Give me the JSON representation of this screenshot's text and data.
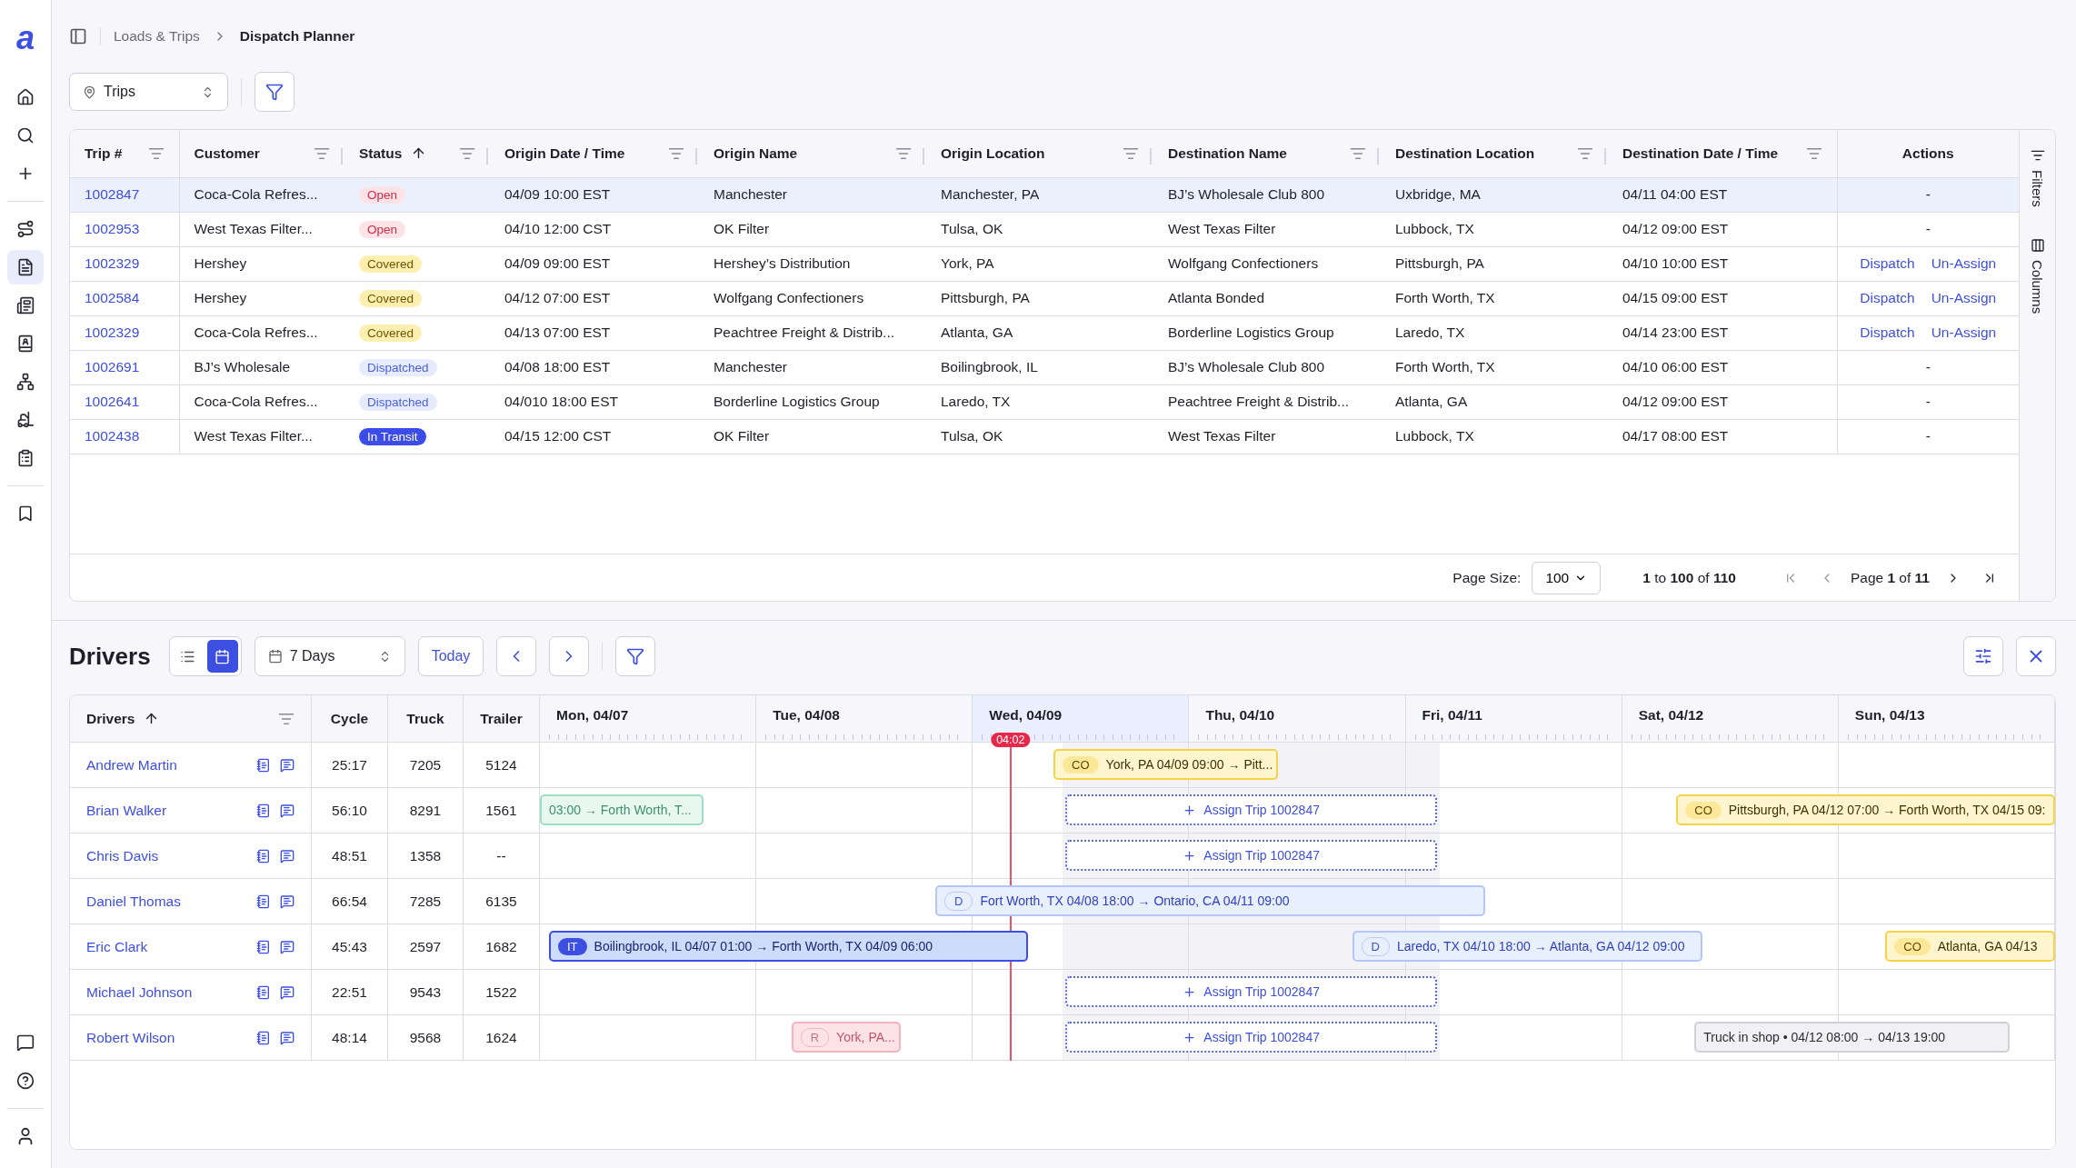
{
  "sidebar": {
    "logo": "a",
    "items": [
      {
        "selected": false
      },
      {
        "selected": false
      },
      {
        "selected": false
      },
      {
        "selected": false
      },
      {
        "selected": true
      },
      {
        "selected": false
      },
      {
        "selected": false
      },
      {
        "selected": false
      },
      {
        "selected": false
      },
      {
        "selected": false
      },
      {
        "selected": false
      }
    ]
  },
  "breadcrumb": [
    "Loads & Trips",
    "Dispatch Planner"
  ],
  "view_select": {
    "value": "Trips"
  },
  "trips_table": {
    "columns": [
      {
        "label": "Trip #",
        "sorted": false,
        "filterable": true
      },
      {
        "label": "Customer",
        "sorted": false,
        "filterable": true
      },
      {
        "label": "Status",
        "sorted": true,
        "filterable": true
      },
      {
        "label": "Origin Date / Time",
        "sorted": false,
        "filterable": true
      },
      {
        "label": "Origin Name",
        "sorted": false,
        "filterable": true
      },
      {
        "label": "Origin Location",
        "sorted": false,
        "filterable": true
      },
      {
        "label": "Destination Name",
        "sorted": false,
        "filterable": true
      },
      {
        "label": "Destination Location",
        "sorted": false,
        "filterable": true
      },
      {
        "label": "Destination Date / Time",
        "sorted": false,
        "filterable": true
      },
      {
        "label": "Actions",
        "sorted": false,
        "filterable": false
      }
    ],
    "rows": [
      {
        "selected": true,
        "cells": [
          "1002847",
          "Coca-Cola Refres...",
          {
            "label": "Open",
            "kind": "open"
          },
          "04/09 10:00 EST",
          "Manchester",
          "Manchester, PA",
          "BJ’s Wholesale Club 800",
          "Uxbridge, MA",
          "04/11 04:00 EST",
          "-"
        ]
      },
      {
        "selected": false,
        "cells": [
          "1002953",
          "West Texas Filter...",
          {
            "label": "Open",
            "kind": "open"
          },
          "04/10 12:00 CST",
          "OK Filter",
          "Tulsa, OK",
          "West Texas Filter",
          "Lubbock, TX",
          "04/12 09:00 EST",
          "-"
        ]
      },
      {
        "selected": false,
        "cells": [
          "1002329",
          "Hershey",
          {
            "label": "Covered",
            "kind": "covered"
          },
          "04/09 09:00 EST",
          "Hershey’s Distribution",
          "York, PA",
          "Wolfgang Confectioners",
          "Pittsburgh, PA",
          "04/10 10:00 EST",
          [
            "Dispatch",
            "Un-Assign"
          ]
        ]
      },
      {
        "selected": false,
        "cells": [
          "1002584",
          "Hershey",
          {
            "label": "Covered",
            "kind": "covered"
          },
          "04/12 07:00 EST",
          "Wolfgang Confectioners",
          "Pittsburgh, PA",
          "Atlanta Bonded",
          "Forth Worth, TX",
          "04/15 09:00 EST",
          [
            "Dispatch",
            "Un-Assign"
          ]
        ]
      },
      {
        "selected": false,
        "cells": [
          "1002329",
          "Coca-Cola Refres...",
          {
            "label": "Covered",
            "kind": "covered"
          },
          "04/13 07:00 EST",
          "Peachtree Freight & Distrib...",
          "Atlanta, GA",
          "Borderline Logistics Group",
          "Laredo, TX",
          "04/14 23:00 EST",
          [
            "Dispatch",
            "Un-Assign"
          ]
        ]
      },
      {
        "selected": false,
        "cells": [
          "1002691",
          "BJ’s Wholesale",
          {
            "label": "Dispatched",
            "kind": "dispatched"
          },
          "04/08 18:00 EST",
          "Manchester",
          "Boilingbrook, IL",
          "BJ’s Wholesale Club 800",
          "Forth Worth, TX",
          "04/10 06:00 EST",
          "-"
        ]
      },
      {
        "selected": false,
        "cells": [
          "1002641",
          "Coca-Cola Refres...",
          {
            "label": "Dispatched",
            "kind": "dispatched"
          },
          "04/010 18:00 EST",
          "Borderline Logistics Group",
          "Laredo, TX",
          "Peachtree Freight & Distrib...",
          "Atlanta, GA",
          "04/12 09:00 EST",
          "-"
        ]
      },
      {
        "selected": false,
        "cells": [
          "1002438",
          "West Texas Filter...",
          {
            "label": "In Transit",
            "kind": "in_transit"
          },
          "04/15 12:00 CST",
          "OK Filter",
          "Tulsa, OK",
          "West Texas Filter",
          "Lubbock, TX",
          "04/17 08:00 EST",
          "-"
        ]
      }
    ],
    "pagination": {
      "page_size_label": "Page Size:",
      "page_size": "100",
      "range": "**1** to **100** of **110**",
      "page": "Page **1** of **11**"
    }
  },
  "side_panel": [
    "Filters",
    "Columns"
  ],
  "drivers": {
    "title": "Drivers",
    "view_toggle": [
      {
        "selected": false
      },
      {
        "selected": true
      }
    ],
    "range_select": "7 Days",
    "today": "Today",
    "columns": [
      {
        "label": "Drivers",
        "sorted": true,
        "filterable": true
      },
      {
        "label": "Cycle",
        "sorted": false,
        "filterable": false
      },
      {
        "label": "Truck",
        "sorted": false,
        "filterable": false
      },
      {
        "label": "Trailer",
        "sorted": false,
        "filterable": false
      }
    ],
    "days": [
      {
        "label": "Mon, 04/07",
        "selected": false
      },
      {
        "label": "Tue, 04/08",
        "selected": false
      },
      {
        "label": "Wed, 04/09",
        "selected": true
      },
      {
        "label": "Thu, 04/10",
        "selected": false
      },
      {
        "label": "Fri, 04/11",
        "selected": false
      },
      {
        "label": "Sat, 04/12",
        "selected": false
      },
      {
        "label": "Sun, 04/13",
        "selected": false
      }
    ],
    "now": "04:02",
    "rows": [
      {
        "name": "Andrew Martin",
        "cycle": "25:17",
        "truck": "7205",
        "trailer": "5124",
        "events": [
          {
            "kind": "covered",
            "badge": "CO",
            "text": "York, PA 04/09 09:00 → Pitt..."
          }
        ]
      },
      {
        "name": "Brian Walker",
        "cycle": "56:10",
        "truck": "8291",
        "trailer": "1561",
        "events": [
          {
            "kind": "completed",
            "text": "03:00 → Forth Worth, T..."
          },
          {
            "kind": "assign",
            "text": "Assign Trip 1002847"
          },
          {
            "kind": "covered",
            "badge": "CO",
            "text": "Pittsburgh, PA 04/12 07:00 → Forth Worth, TX 04/15 09:"
          }
        ]
      },
      {
        "name": "Chris Davis",
        "cycle": "48:51",
        "truck": "1358",
        "trailer": "--",
        "events": [
          {
            "kind": "assign",
            "text": "Assign Trip 1002847"
          }
        ]
      },
      {
        "name": "Daniel Thomas",
        "cycle": "66:54",
        "truck": "7285",
        "trailer": "6135",
        "events": [
          {
            "kind": "dispatched",
            "badge": "D",
            "text": "Fort Worth, TX 04/08 18:00 → Ontario, CA 04/11 09:00"
          }
        ]
      },
      {
        "name": "Eric Clark",
        "cycle": "45:43",
        "truck": "2597",
        "trailer": "1682",
        "events": [
          {
            "kind": "in_transit",
            "badge": "IT",
            "text": "Boilingbrook, IL 04/07 01:00 → Forth Worth, TX 04/09 06:00"
          },
          {
            "kind": "dispatched",
            "badge": "D",
            "text": "Laredo, TX 04/10 18:00 → Atlanta, GA 04/12 09:00"
          },
          {
            "kind": "covered",
            "badge": "CO",
            "text": "Atlanta, GA 04/13"
          }
        ]
      },
      {
        "name": "Michael Johnson",
        "cycle": "22:51",
        "truck": "9543",
        "trailer": "1522",
        "events": [
          {
            "kind": "assign",
            "text": "Assign Trip 1002847"
          }
        ]
      },
      {
        "name": "Robert Wilson",
        "cycle": "48:14",
        "truck": "9568",
        "trailer": "1624",
        "events": [
          {
            "kind": "rejected",
            "badge": "R",
            "text": "York, PA..."
          },
          {
            "kind": "assign",
            "text": "Assign Trip 1002847"
          },
          {
            "kind": "shop",
            "text": "Truck in shop • 04/12 08:00 → 04/13 19:00"
          }
        ]
      }
    ]
  }
}
